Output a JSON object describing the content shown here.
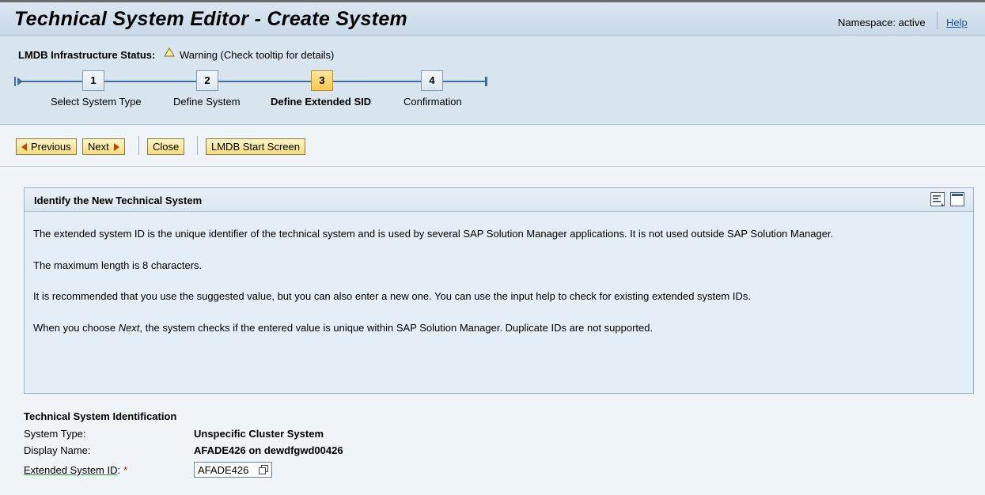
{
  "header": {
    "title": "Technical System Editor - Create System",
    "namespace": "Namespace: active",
    "help": "Help"
  },
  "status": {
    "label": "LMDB Infrastructure Status:",
    "warning_icon": "warning-triangle-icon",
    "text": "Warning (Check tooltip for details)"
  },
  "roadmap": {
    "steps": [
      {
        "number": "1",
        "label": "Select System Type"
      },
      {
        "number": "2",
        "label": "Define System"
      },
      {
        "number": "3",
        "label": "Define Extended SID"
      },
      {
        "number": "4",
        "label": "Confirmation"
      }
    ],
    "active_step": "3",
    "active_color": "#f8c94e"
  },
  "toolbar": {
    "previous": "Previous",
    "next": "Next",
    "close": "Close",
    "lmdb_start": "LMDB Start Screen"
  },
  "panel": {
    "title": "Identify the New Technical System",
    "icons": [
      "text-layout-icon",
      "collapse-panel-icon"
    ],
    "paragraphs": [
      "The extended system ID is the unique identifier of the technical system and is used by several SAP Solution Manager applications. It is not used outside SAP Solution Manager.",
      "The maximum length is 8 characters.",
      "It is recommended that you use the suggested value, but you can also enter a new one. You can use the input help to check for existing extended system IDs."
    ],
    "last_paragraph": {
      "before": "When you choose ",
      "emphasis": "Next",
      "after": ", the system checks if the entered value is unique within SAP Solution Manager. Duplicate IDs are not supported."
    }
  },
  "identification": {
    "title": "Technical System Identification",
    "system_type_label": "System Type:",
    "system_type_value": "Unspecific Cluster System",
    "display_name_label": "Display Name:",
    "display_name_value": "AFADE426 on dewdfgwd00426",
    "ext_sid_label": "Extended System ID",
    "ext_sid_colon": ":",
    "required_marker": "*",
    "ext_sid_value": "AFADE426"
  },
  "colors": {
    "accent": "#3b6e9c",
    "button": "#f7dc7d",
    "required": "#d00000",
    "link": "#1f58a0"
  }
}
